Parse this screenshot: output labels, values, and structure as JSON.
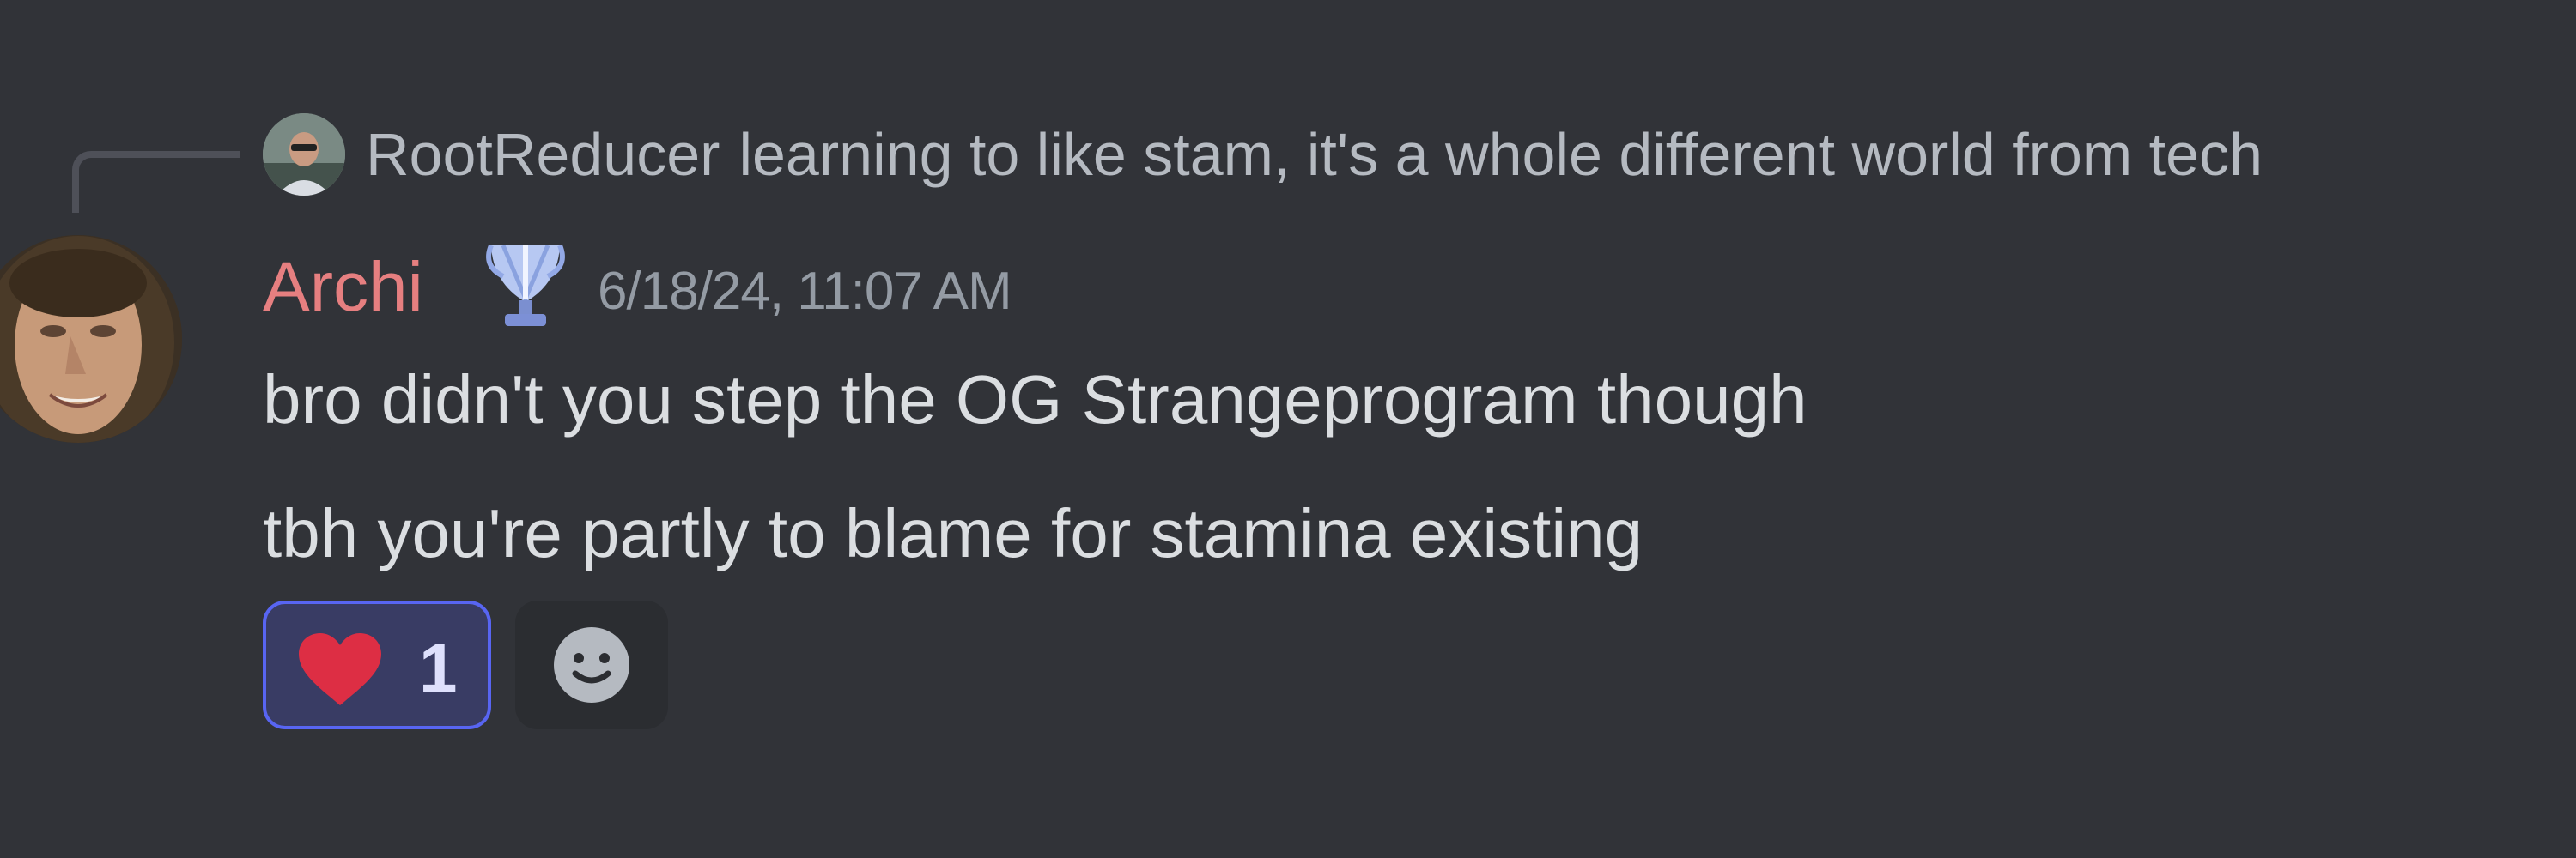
{
  "reply": {
    "author": "RootReducer",
    "text": "learning to like stam, it's a whole different world from tech",
    "avatar_icon": "user-avatar-photo"
  },
  "message": {
    "author": "Archi",
    "author_color": "#e67f80",
    "role_icon": "trophy-icon",
    "timestamp": "6/18/24, 11:07 AM",
    "avatar_icon": "user-avatar-photo",
    "lines": [
      "bro didn't you step the OG Strangeprogram though",
      "tbh you're partly to blame for stamina existing"
    ]
  },
  "reactions": [
    {
      "emoji_icon": "heart-icon",
      "count": "1",
      "selected": true,
      "accent": "#5865f2"
    }
  ],
  "add_reaction": {
    "icon": "smile-icon"
  }
}
